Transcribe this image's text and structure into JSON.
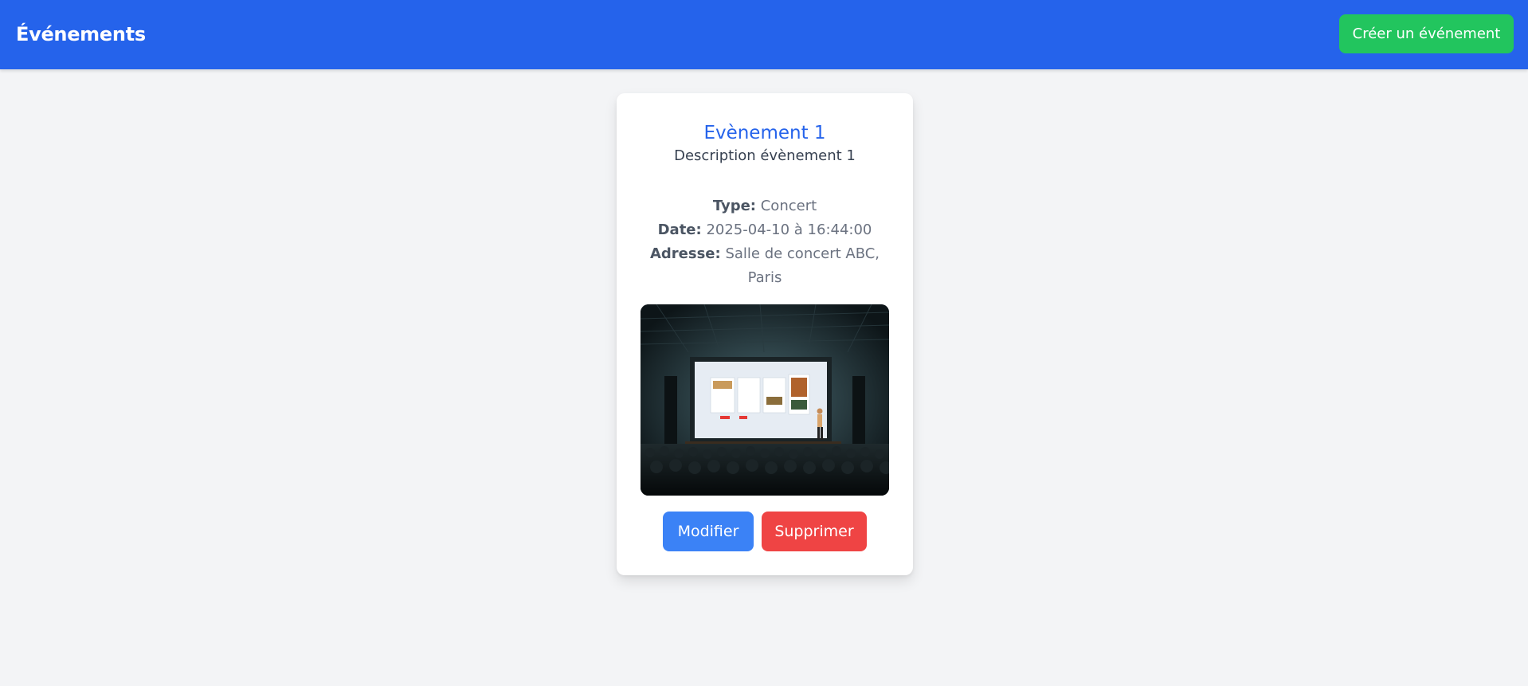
{
  "header": {
    "title": "Événements",
    "create_button_label": "Créer un événement"
  },
  "event": {
    "title": "Evènement 1",
    "description": "Description évènement 1",
    "type_label": "Type:",
    "type_value": "Concert",
    "date_label": "Date:",
    "date_value": "2025-04-10 à 16:44:00",
    "address_label": "Adresse:",
    "address_value": "Salle de concert ABC, Paris",
    "edit_button_label": "Modifier",
    "delete_button_label": "Supprimer"
  },
  "colors": {
    "header_bg": "#2563eb",
    "create_button": "#22c55e",
    "title_accent": "#2563eb",
    "edit_button": "#3b82f6",
    "delete_button": "#ef4444",
    "page_bg": "#f3f4f6"
  }
}
